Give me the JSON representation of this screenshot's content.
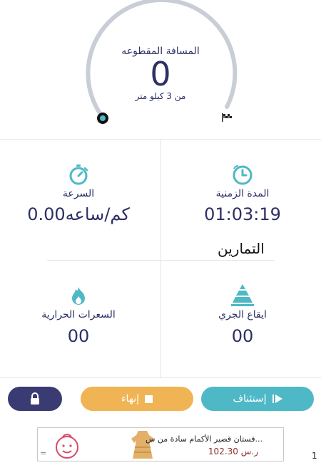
{
  "gauge": {
    "title": "المسافة المقطوعه",
    "value": "0",
    "target": "من 3 كيلو متر",
    "progress": 0
  },
  "stats": {
    "speed": {
      "icon": "stopwatch-icon",
      "label": "السرعة",
      "value": "0.00كم/ساعه"
    },
    "duration": {
      "icon": "clock-icon",
      "label": "المدة الزمنية",
      "value": "01:03:19"
    },
    "calories": {
      "icon": "flame-icon",
      "label": "السعرات الحرارية",
      "value": "00"
    },
    "pace": {
      "icon": "pyramid-icon",
      "label": "ايقاع الجري",
      "value": "00"
    }
  },
  "exercises": {
    "title": "التمارين"
  },
  "actions": {
    "resume_label": "إستئناف",
    "finish_label": "إنهاء",
    "lock_icon": "lock-icon"
  },
  "ad": {
    "title": "...فستان قصير الأكمام سادة من س",
    "price": "ر.س 102.30",
    "badge": "="
  },
  "page_number": "1",
  "colors": {
    "primary": "#2d2f66",
    "teal": "#4fb8c6",
    "amber": "#f0b454",
    "navy": "#3a3b72",
    "arc": "#c9ced6",
    "divider": "#e3e5ea"
  }
}
